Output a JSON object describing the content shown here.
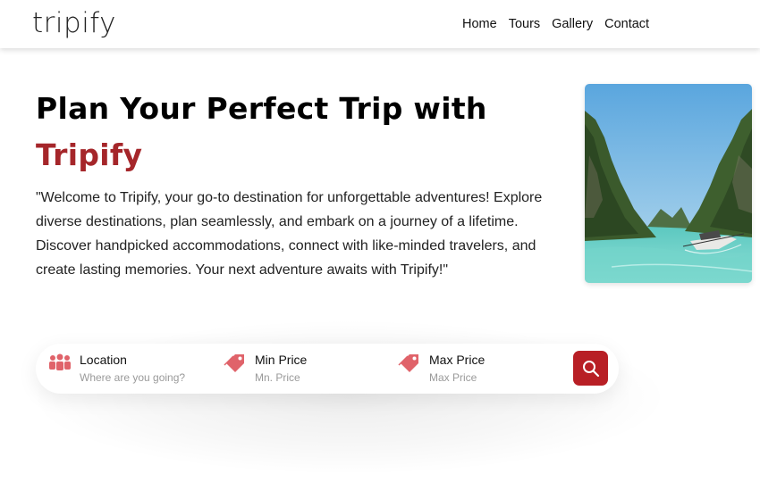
{
  "header": {
    "logo": "tripify",
    "nav": [
      {
        "label": "Home"
      },
      {
        "label": "Tours"
      },
      {
        "label": "Gallery"
      },
      {
        "label": "Contact"
      }
    ]
  },
  "hero": {
    "title_line1": "Plan Your Perfect Trip with",
    "title_brand": "Tripify",
    "description": "\"Welcome to Tripify, your go-to destination for unforgettable adventures! Explore diverse destinations, plan seamlessly, and embark on a journey of a lifetime. Discover handpicked accommodations, connect with like-minded travelers, and create lasting memories. Your next adventure awaits with Tripify!\""
  },
  "search": {
    "location": {
      "label": "Location",
      "placeholder": "Where are you going?",
      "icon": "people-icon"
    },
    "min_price": {
      "label": "Min Price",
      "placeholder": "Mn. Price",
      "icon": "price-tag-icon"
    },
    "max_price": {
      "label": "Max Price",
      "placeholder": "Max Price",
      "icon": "price-tag-icon"
    },
    "button_icon": "search-icon"
  },
  "colors": {
    "brand": "#a5262a",
    "button": "#b81f25",
    "icon": "#e0636a"
  }
}
